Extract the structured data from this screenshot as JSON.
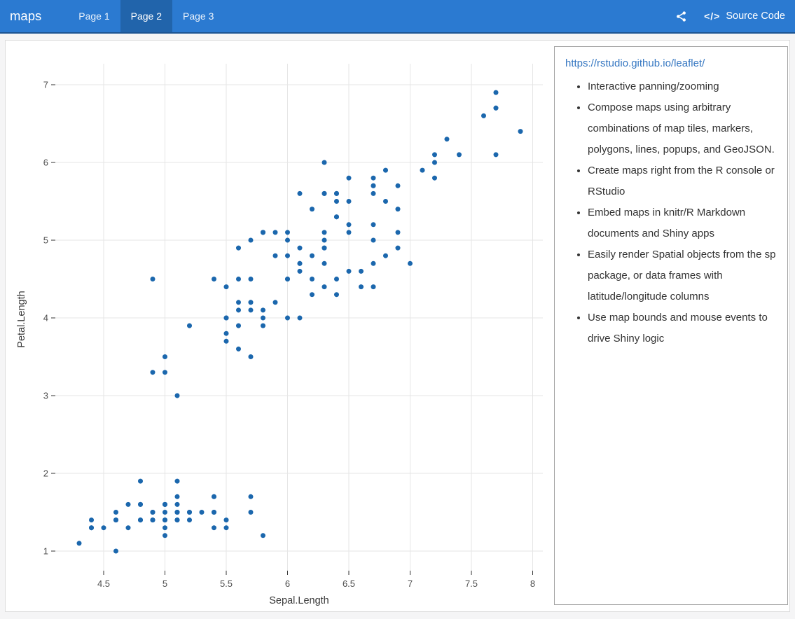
{
  "navbar": {
    "brand": "maps",
    "tabs": [
      {
        "label": "Page 1",
        "active": false
      },
      {
        "label": "Page 2",
        "active": true
      },
      {
        "label": "Page 3",
        "active": false
      }
    ],
    "source_code_label": "Source Code",
    "code_glyph": "</>"
  },
  "info_panel": {
    "link": "https://rstudio.github.io/leaflet/",
    "bullets": [
      "Interactive panning/zooming",
      "Compose maps using arbitrary combinations of map tiles, markers, polygons, lines, popups, and GeoJSON.",
      "Create maps right from the R console or RStudio",
      "Embed maps in knitr/R Markdown documents and Shiny apps",
      "Easily render Spatial objects from the sp package, or data frames with latitude/longitude columns",
      "Use map bounds and mouse events to drive Shiny logic"
    ]
  },
  "colors": {
    "navbar_bg": "#2b7ad1",
    "navbar_active_bg": "#2164ab",
    "navbar_border": "#1c5492",
    "link": "#3778c2",
    "gridline": "#e5e5e5",
    "tick_text": "#4d4d4d",
    "axis_title": "#383838",
    "point": "#1b67ad"
  },
  "chart_data": {
    "type": "scatter",
    "title": "",
    "xlabel": "Sepal.Length",
    "ylabel": "Petal.Length",
    "x_ticks": [
      4.5,
      5,
      5.5,
      6,
      6.5,
      7,
      7.5,
      8
    ],
    "y_ticks": [
      1,
      2,
      3,
      4,
      5,
      6,
      7
    ],
    "xlim": [
      4.1,
      8.1
    ],
    "ylim": [
      0.7,
      7.2
    ],
    "grid": true,
    "legend": false,
    "point_color": "#1b67ad",
    "points": [
      [
        5.1,
        1.4
      ],
      [
        4.9,
        1.4
      ],
      [
        4.7,
        1.3
      ],
      [
        4.6,
        1.5
      ],
      [
        5.0,
        1.4
      ],
      [
        5.4,
        1.7
      ],
      [
        4.6,
        1.4
      ],
      [
        5.0,
        1.5
      ],
      [
        4.4,
        1.4
      ],
      [
        4.9,
        1.5
      ],
      [
        5.4,
        1.5
      ],
      [
        4.8,
        1.6
      ],
      [
        4.8,
        1.4
      ],
      [
        4.3,
        1.1
      ],
      [
        5.8,
        1.2
      ],
      [
        5.7,
        1.5
      ],
      [
        5.4,
        1.3
      ],
      [
        5.1,
        1.4
      ],
      [
        5.7,
        1.7
      ],
      [
        5.1,
        1.5
      ],
      [
        5.4,
        1.7
      ],
      [
        5.1,
        1.5
      ],
      [
        4.6,
        1.0
      ],
      [
        5.1,
        1.7
      ],
      [
        4.8,
        1.9
      ],
      [
        5.0,
        1.6
      ],
      [
        5.0,
        1.6
      ],
      [
        5.2,
        1.5
      ],
      [
        5.2,
        1.4
      ],
      [
        4.7,
        1.6
      ],
      [
        4.8,
        1.6
      ],
      [
        5.4,
        1.5
      ],
      [
        5.2,
        1.5
      ],
      [
        5.5,
        1.4
      ],
      [
        4.9,
        1.5
      ],
      [
        5.0,
        1.2
      ],
      [
        5.5,
        1.3
      ],
      [
        4.9,
        1.4
      ],
      [
        4.4,
        1.3
      ],
      [
        5.1,
        1.5
      ],
      [
        5.0,
        1.3
      ],
      [
        4.5,
        1.3
      ],
      [
        4.4,
        1.3
      ],
      [
        5.0,
        1.6
      ],
      [
        5.1,
        1.9
      ],
      [
        4.8,
        1.4
      ],
      [
        5.1,
        1.6
      ],
      [
        4.6,
        1.4
      ],
      [
        5.3,
        1.5
      ],
      [
        5.0,
        1.4
      ],
      [
        7.0,
        4.7
      ],
      [
        6.4,
        4.5
      ],
      [
        6.9,
        4.9
      ],
      [
        5.5,
        4.0
      ],
      [
        6.5,
        4.6
      ],
      [
        5.7,
        4.5
      ],
      [
        6.3,
        4.7
      ],
      [
        4.9,
        3.3
      ],
      [
        6.6,
        4.6
      ],
      [
        5.2,
        3.9
      ],
      [
        5.0,
        3.5
      ],
      [
        5.9,
        4.2
      ],
      [
        6.0,
        4.0
      ],
      [
        6.1,
        4.7
      ],
      [
        5.6,
        3.6
      ],
      [
        6.7,
        4.4
      ],
      [
        5.6,
        4.5
      ],
      [
        5.8,
        4.1
      ],
      [
        6.2,
        4.5
      ],
      [
        5.6,
        3.9
      ],
      [
        5.9,
        4.8
      ],
      [
        6.1,
        4.0
      ],
      [
        6.3,
        4.9
      ],
      [
        6.1,
        4.7
      ],
      [
        6.4,
        4.3
      ],
      [
        6.6,
        4.4
      ],
      [
        6.8,
        4.8
      ],
      [
        6.7,
        5.0
      ],
      [
        6.0,
        4.5
      ],
      [
        5.7,
        3.5
      ],
      [
        5.5,
        3.8
      ],
      [
        5.5,
        3.7
      ],
      [
        5.8,
        3.9
      ],
      [
        6.0,
        5.1
      ],
      [
        5.4,
        4.5
      ],
      [
        6.0,
        4.5
      ],
      [
        6.7,
        4.7
      ],
      [
        6.3,
        4.4
      ],
      [
        5.6,
        4.1
      ],
      [
        5.5,
        4.0
      ],
      [
        5.5,
        4.4
      ],
      [
        6.1,
        4.6
      ],
      [
        5.8,
        4.0
      ],
      [
        5.0,
        3.3
      ],
      [
        5.6,
        4.2
      ],
      [
        5.7,
        4.2
      ],
      [
        5.7,
        4.2
      ],
      [
        6.2,
        4.3
      ],
      [
        5.1,
        3.0
      ],
      [
        5.7,
        4.1
      ],
      [
        6.3,
        6.0
      ],
      [
        5.8,
        5.1
      ],
      [
        7.1,
        5.9
      ],
      [
        6.3,
        5.6
      ],
      [
        6.5,
        5.8
      ],
      [
        7.6,
        6.6
      ],
      [
        4.9,
        4.5
      ],
      [
        7.3,
        6.3
      ],
      [
        6.7,
        5.8
      ],
      [
        7.2,
        6.1
      ],
      [
        6.5,
        5.1
      ],
      [
        6.4,
        5.3
      ],
      [
        6.8,
        5.5
      ],
      [
        5.7,
        5.0
      ],
      [
        5.8,
        5.1
      ],
      [
        6.4,
        5.3
      ],
      [
        6.5,
        5.5
      ],
      [
        7.7,
        6.7
      ],
      [
        7.7,
        6.9
      ],
      [
        6.0,
        5.0
      ],
      [
        6.9,
        5.7
      ],
      [
        5.6,
        4.9
      ],
      [
        7.7,
        6.7
      ],
      [
        6.3,
        4.9
      ],
      [
        6.7,
        5.7
      ],
      [
        7.2,
        6.0
      ],
      [
        6.2,
        4.8
      ],
      [
        6.1,
        4.9
      ],
      [
        6.4,
        5.6
      ],
      [
        7.2,
        5.8
      ],
      [
        7.4,
        6.1
      ],
      [
        7.9,
        6.4
      ],
      [
        6.4,
        5.6
      ],
      [
        6.3,
        5.1
      ],
      [
        6.1,
        5.6
      ],
      [
        7.7,
        6.1
      ],
      [
        6.3,
        5.6
      ],
      [
        6.4,
        5.5
      ],
      [
        6.0,
        4.8
      ],
      [
        6.9,
        5.4
      ],
      [
        6.7,
        5.6
      ],
      [
        6.9,
        5.1
      ],
      [
        5.8,
        5.1
      ],
      [
        6.8,
        5.9
      ],
      [
        6.7,
        5.7
      ],
      [
        6.7,
        5.2
      ],
      [
        6.3,
        5.0
      ],
      [
        6.5,
        5.2
      ],
      [
        6.2,
        5.4
      ],
      [
        5.9,
        5.1
      ]
    ]
  }
}
